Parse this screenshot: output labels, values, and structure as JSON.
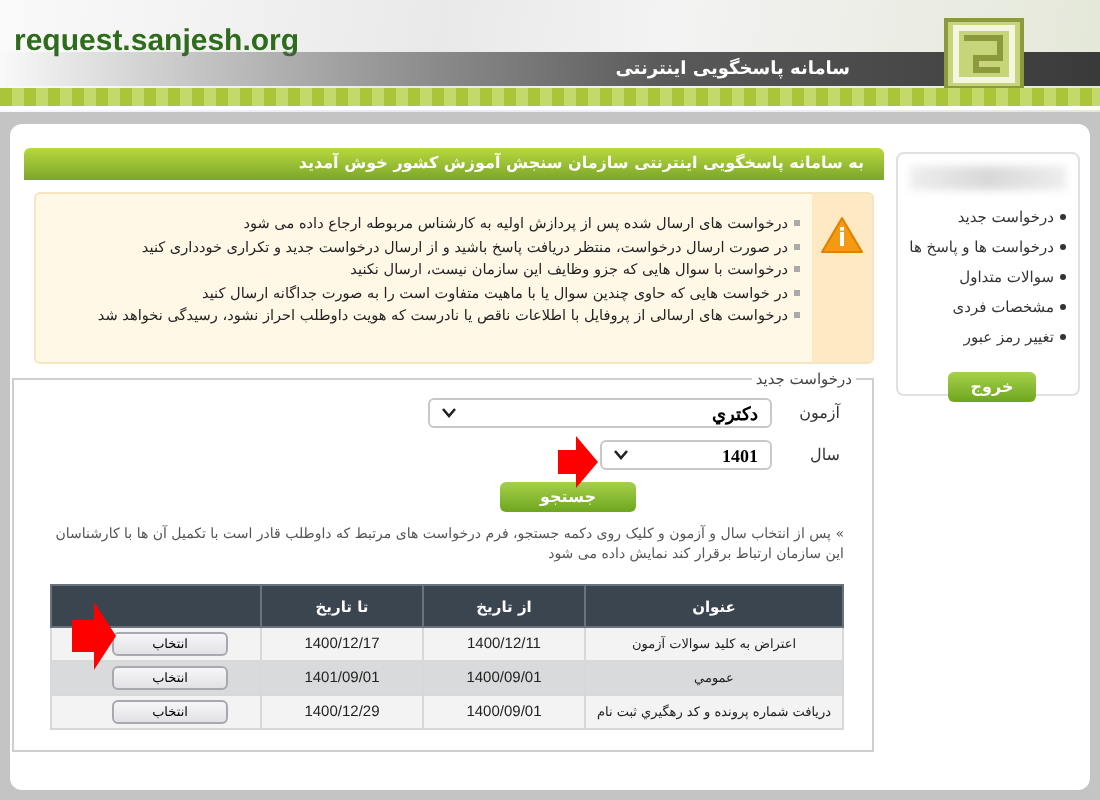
{
  "header": {
    "site": "request.sanjesh.org",
    "title": "سامانه پاسخگویی اینترنتی"
  },
  "sidebar": {
    "items": [
      "درخواست جدید",
      "درخواست ها و پاسخ ها",
      "سوالات متداول",
      "مشخصات فردی",
      "تغییر رمز عبور"
    ],
    "logout": "خروج"
  },
  "welcome": "به سامانه پاسخگویی اینترنتی سازمان سنجش آموزش کشور خوش آمدید",
  "notices": [
    "درخواست های ارسال شده پس از پردازش اولیه به کارشناس مربوطه ارجاع داده می شود",
    "در صورت ارسال درخواست، منتظر دریافت پاسخ باشید و از ارسال درخواست جدید و تکراری خودداری کنید",
    "درخواست با سوال هایی که جزو وظایف این سازمان نیست، ارسال نکنید",
    "در خواست هایی که حاوی چندین سوال یا با ماهیت متفاوت است را به صورت جداگانه ارسال کنید",
    "درخواست های ارسالی از پروفایل با اطلاعات ناقص یا نادرست که هویت داوطلب احراز نشود، رسیدگی نخواهد شد"
  ],
  "form": {
    "legend": "درخواست جدید",
    "fields": [
      {
        "label": "آزمون",
        "value": "دكتري"
      },
      {
        "label": "سال",
        "value": "1401"
      }
    ],
    "search": "جستجو",
    "hint": "» پس از انتخاب سال و آزمون و کلیک روی دکمه جستجو، فرم درخواست های مرتبط که داوطلب قادر است با تکمیل آن ها با کارشناسان این سازمان ارتباط برقرار کند نمایش داده می شود"
  },
  "table": {
    "columns": [
      "عنوان",
      "از تاریخ",
      "تا تاریخ"
    ],
    "rows": [
      {
        "title": "اعتراض به کلید سوالات آزمون",
        "from": "1400/12/11",
        "to": "1400/12/17",
        "action": "انتخاب"
      },
      {
        "title": "عمومي",
        "from": "1400/09/01",
        "to": "1401/09/01",
        "action": "انتخاب"
      },
      {
        "title": "دریافت شماره پرونده و کد رهگیري ثبت نام",
        "from": "1400/09/01",
        "to": "1400/12/29",
        "action": "انتخاب"
      }
    ]
  }
}
